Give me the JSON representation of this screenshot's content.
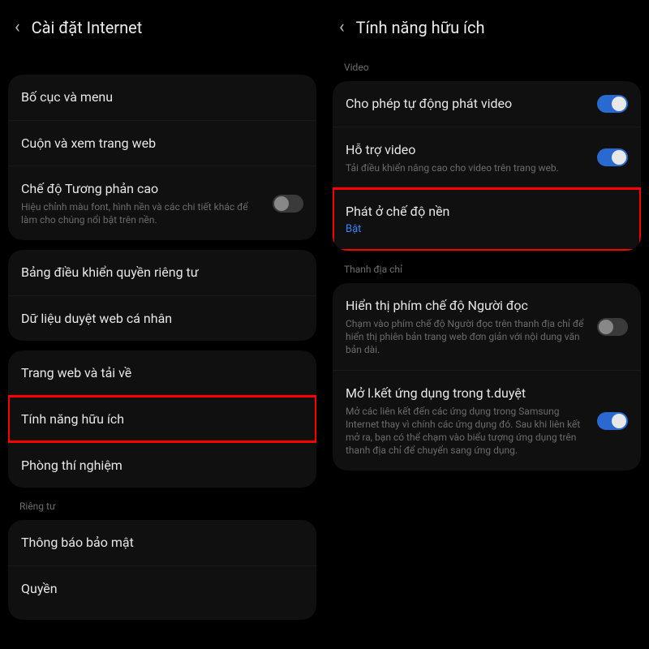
{
  "left": {
    "header": "Cài đặt Internet",
    "rows": {
      "layout": "Bố cục và menu",
      "scroll": "Cuộn và xem trang web",
      "contrast_title": "Chế độ Tương phản cao",
      "contrast_sub": "Hiệu chỉnh màu font, hình nền và các chi tiết khác để làm cho chúng nổi bật trên nền.",
      "privacy_dash": "Bảng điều khiển quyền riêng tư",
      "personal_data": "Dữ liệu duyệt web cá nhân",
      "sites_download": "Trang web và tải về",
      "useful": "Tính năng hữu ích",
      "labs": "Phòng thí nghiệm",
      "sec_notice": "Thông báo bảo mật",
      "permissions": "Quyền"
    },
    "section_privacy": "Riêng tư"
  },
  "right": {
    "header": "Tính năng hữu ích",
    "section_video": "Video",
    "section_address": "Thanh địa chỉ",
    "rows": {
      "autoplay": "Cho phép tự động phát video",
      "video_assist_title": "Hỗ trợ video",
      "video_assist_sub": "Tải điều khiển nâng cao cho video trên trang web.",
      "bg_play_title": "Phát ở chế độ nền",
      "bg_play_sub": "Bật",
      "reader_title": "Hiển thị phím chế độ Người đọc",
      "reader_sub": "Chạm vào phím chế độ Người đọc trên thanh địa chỉ để hiển thị phiên bản trang web đơn giản với nội dung văn bản dài.",
      "open_links_title": "Mở l.kết ứng dụng trong t.duyệt",
      "open_links_sub": "Mở các liên kết đến các ứng dụng trong Samsung Internet thay vì chính các ứng dụng đó. Sau khi liên kết mở ra, bạn có thể chạm vào biểu tượng ứng dụng trên thanh địa chỉ để chuyển sang ứng dụng."
    }
  }
}
